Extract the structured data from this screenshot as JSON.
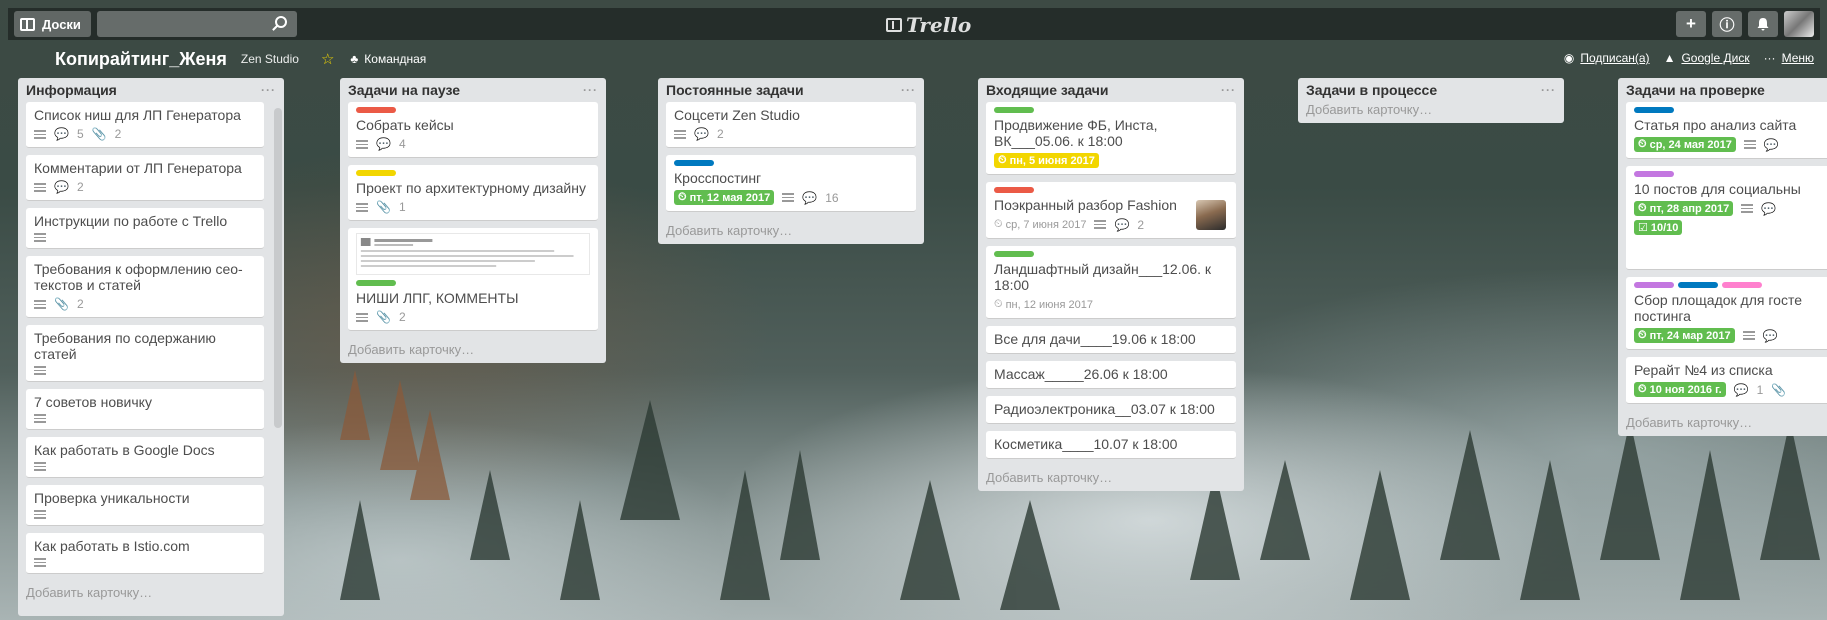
{
  "topbar": {
    "boards_label": "Доски",
    "logo_text": "Trello",
    "add_symbol": "+",
    "info_symbol": "ⓘ",
    "bell_symbol": "🔔"
  },
  "header": {
    "board_title": "Копирайтинг_Женя",
    "team_name": "Zen Studio",
    "visibility": "Командная",
    "subscribed": "Подписан(а)",
    "google_drive": "Google Диск",
    "menu": "Меню"
  },
  "add_card_label": "Добавить карточку…",
  "colors": {
    "green": "#61bd4f",
    "red": "#eb5a46",
    "yellow": "#f2d600",
    "blue": "#0079bf",
    "purple": "#c377e0",
    "pink": "#ff80ce"
  },
  "lists": [
    {
      "title": "Информация",
      "cards": [
        {
          "title": "Список ниш для ЛП Генератора",
          "comments": "5",
          "attachments": "2"
        },
        {
          "title": "Комментарии от ЛП Генератора",
          "comments": "2"
        },
        {
          "title": "Инструкции по работе с Trello"
        },
        {
          "title": "Требования к оформлению сео-текстов и статей",
          "attachments": "2"
        },
        {
          "title": "Требования по содержанию статей"
        },
        {
          "title": "7 советов новичку"
        },
        {
          "title": "Как работать в Google Docs"
        },
        {
          "title": "Проверка уникальности"
        },
        {
          "title": "Как работать в Istio.com"
        }
      ]
    },
    {
      "title": "Задачи на паузе",
      "cards": [
        {
          "title": "Собрать кейсы",
          "comments": "4"
        },
        {
          "title": "Проект по архитектурному дизайну",
          "attachments": "1"
        },
        {
          "title": "НИШИ ЛПГ, КОММЕНТЫ",
          "attachments": "2"
        }
      ]
    },
    {
      "title": "Постоянные задачи",
      "cards": [
        {
          "title": "Соцсети Zen Studio",
          "comments": "2"
        },
        {
          "title": "Кросспостинг",
          "due": "пт, 12 мая 2017",
          "comments": "16"
        }
      ]
    },
    {
      "title": "Входящие задачи",
      "cards": [
        {
          "title": "Продвижение ФБ, Инста, ВК___05.06. к 18:00",
          "due": "пн, 5 июня 2017"
        },
        {
          "title": "Поэкранный разбор Fashion",
          "due": "ср, 7 июня 2017",
          "comments": "2"
        },
        {
          "title": "Ландшафтный дизайн___12.06. к 18:00",
          "due": "пн, 12 июня 2017"
        },
        {
          "title": "Все для дачи____19.06 к 18:00"
        },
        {
          "title": "Массаж_____26.06 к 18:00"
        },
        {
          "title": "Радиоэлектроника__03.07 к 18:00"
        },
        {
          "title": "Косметика____10.07 к 18:00"
        }
      ]
    },
    {
      "title": "Задачи в процессе",
      "cards": []
    },
    {
      "title": "Задачи на проверке",
      "cards": [
        {
          "title": "Статья про анализ сайта",
          "due": "ср, 24 мая 2017"
        },
        {
          "title": "10 постов для социальны",
          "due": "пт, 28 апр 2017",
          "checklist": "10/10"
        },
        {
          "title": "Сбор площадок для госте постинга",
          "due": "пт, 24 мар 2017"
        },
        {
          "title": "Рерайт №4 из списка",
          "due": "10 ноя 2016 г.",
          "comments": "1"
        }
      ]
    }
  ]
}
